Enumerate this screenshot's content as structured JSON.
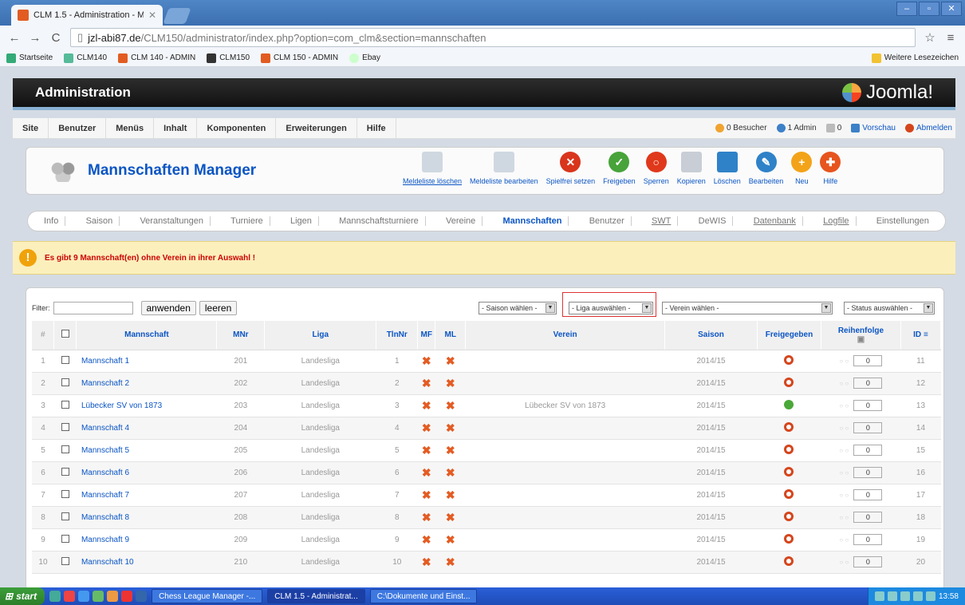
{
  "browser": {
    "tab_title": "CLM 1.5 - Administration - Ma",
    "url_host": "jzl-abi87.de",
    "url_path": "/CLM150/administrator/index.php?option=com_clm&section=mannschaften",
    "bookmarks": [
      "Startseite",
      "CLM140",
      "CLM 140 - ADMIN",
      "CLM150",
      "CLM 150 - ADMIN",
      "Ebay"
    ],
    "bookmarks_other": "Weitere Lesezeichen"
  },
  "header": {
    "title": "Administration",
    "logo_text": "Joomla!"
  },
  "menu": {
    "items": [
      "Site",
      "Benutzer",
      "Menüs",
      "Inhalt",
      "Komponenten",
      "Erweiterungen",
      "Hilfe"
    ],
    "status": {
      "visitors": "0 Besucher",
      "admins": "1 Admin",
      "messages": "0",
      "preview": "Vorschau",
      "logout": "Abmelden"
    }
  },
  "page": {
    "title": "Mannschaften Manager"
  },
  "toolbar": [
    {
      "label": "Meldeliste löschen",
      "color": "#cfd8e0"
    },
    {
      "label": "Meldeliste bearbeiten",
      "color": "#cfd8e0"
    },
    {
      "label": "Spielfrei setzen",
      "color": "#d9341c"
    },
    {
      "label": "Freigeben",
      "color": "#47a33a"
    },
    {
      "label": "Sperren",
      "color": "#e0381b"
    },
    {
      "label": "Kopieren",
      "color": "#c9ced6"
    },
    {
      "label": "Löschen",
      "color": "#2f82c8"
    },
    {
      "label": "Bearbeiten",
      "color": "#2f82c8"
    },
    {
      "label": "Neu",
      "color": "#f3a319"
    },
    {
      "label": "Hilfe",
      "color": "#e7541e"
    }
  ],
  "subnav": [
    "Info",
    "Saison",
    "Veranstaltungen",
    "Turniere",
    "Ligen",
    "Mannschaftsturniere",
    "Vereine",
    "Mannschaften",
    "Benutzer",
    "SWT",
    "DeWIS",
    "Datenbank",
    "Logfile",
    "Einstellungen"
  ],
  "notice": "Es gibt 9 Mannschaft(en) ohne Verein in ihrer Auswahl !",
  "filter": {
    "label": "Filter:",
    "apply": "anwenden",
    "clear": "leeren",
    "saison": "- Saison wählen -",
    "liga": "- Liga auswählen -",
    "verein": "- Verein wählen -",
    "status": "- Status auswählen -"
  },
  "table": {
    "headers": [
      "#",
      "",
      "Mannschaft",
      "MNr",
      "Liga",
      "TlnNr",
      "MF",
      "ML",
      "Verein",
      "Saison",
      "Freigegeben",
      "Reihenfolge",
      "ID"
    ],
    "rows": [
      {
        "n": "1",
        "name": "Mannschaft 1",
        "mnr": "201",
        "liga": "Landesliga",
        "tln": "1",
        "verein": "",
        "saison": "2014/15",
        "freigegeben": "red",
        "order": "0",
        "id": "11"
      },
      {
        "n": "2",
        "name": "Mannschaft 2",
        "mnr": "202",
        "liga": "Landesliga",
        "tln": "2",
        "verein": "",
        "saison": "2014/15",
        "freigegeben": "red",
        "order": "0",
        "id": "12"
      },
      {
        "n": "3",
        "name": "Lübecker SV von 1873",
        "mnr": "203",
        "liga": "Landesliga",
        "tln": "3",
        "verein": "Lübecker SV von 1873",
        "saison": "2014/15",
        "freigegeben": "green",
        "order": "0",
        "id": "13"
      },
      {
        "n": "4",
        "name": "Mannschaft 4",
        "mnr": "204",
        "liga": "Landesliga",
        "tln": "4",
        "verein": "",
        "saison": "2014/15",
        "freigegeben": "red",
        "order": "0",
        "id": "14"
      },
      {
        "n": "5",
        "name": "Mannschaft 5",
        "mnr": "205",
        "liga": "Landesliga",
        "tln": "5",
        "verein": "",
        "saison": "2014/15",
        "freigegeben": "red",
        "order": "0",
        "id": "15"
      },
      {
        "n": "6",
        "name": "Mannschaft 6",
        "mnr": "206",
        "liga": "Landesliga",
        "tln": "6",
        "verein": "",
        "saison": "2014/15",
        "freigegeben": "red",
        "order": "0",
        "id": "16"
      },
      {
        "n": "7",
        "name": "Mannschaft 7",
        "mnr": "207",
        "liga": "Landesliga",
        "tln": "7",
        "verein": "",
        "saison": "2014/15",
        "freigegeben": "red",
        "order": "0",
        "id": "17"
      },
      {
        "n": "8",
        "name": "Mannschaft 8",
        "mnr": "208",
        "liga": "Landesliga",
        "tln": "8",
        "verein": "",
        "saison": "2014/15",
        "freigegeben": "red",
        "order": "0",
        "id": "18"
      },
      {
        "n": "9",
        "name": "Mannschaft 9",
        "mnr": "209",
        "liga": "Landesliga",
        "tln": "9",
        "verein": "",
        "saison": "2014/15",
        "freigegeben": "red",
        "order": "0",
        "id": "19"
      },
      {
        "n": "10",
        "name": "Mannschaft 10",
        "mnr": "210",
        "liga": "Landesliga",
        "tln": "10",
        "verein": "",
        "saison": "2014/15",
        "freigegeben": "red",
        "order": "0",
        "id": "20"
      }
    ]
  },
  "taskbar": {
    "start": "start",
    "tasks": [
      "Chess League Manager -...",
      "CLM 1.5 - Administrat...",
      "C:\\Dokumente und Einst..."
    ],
    "time": "13:58"
  }
}
